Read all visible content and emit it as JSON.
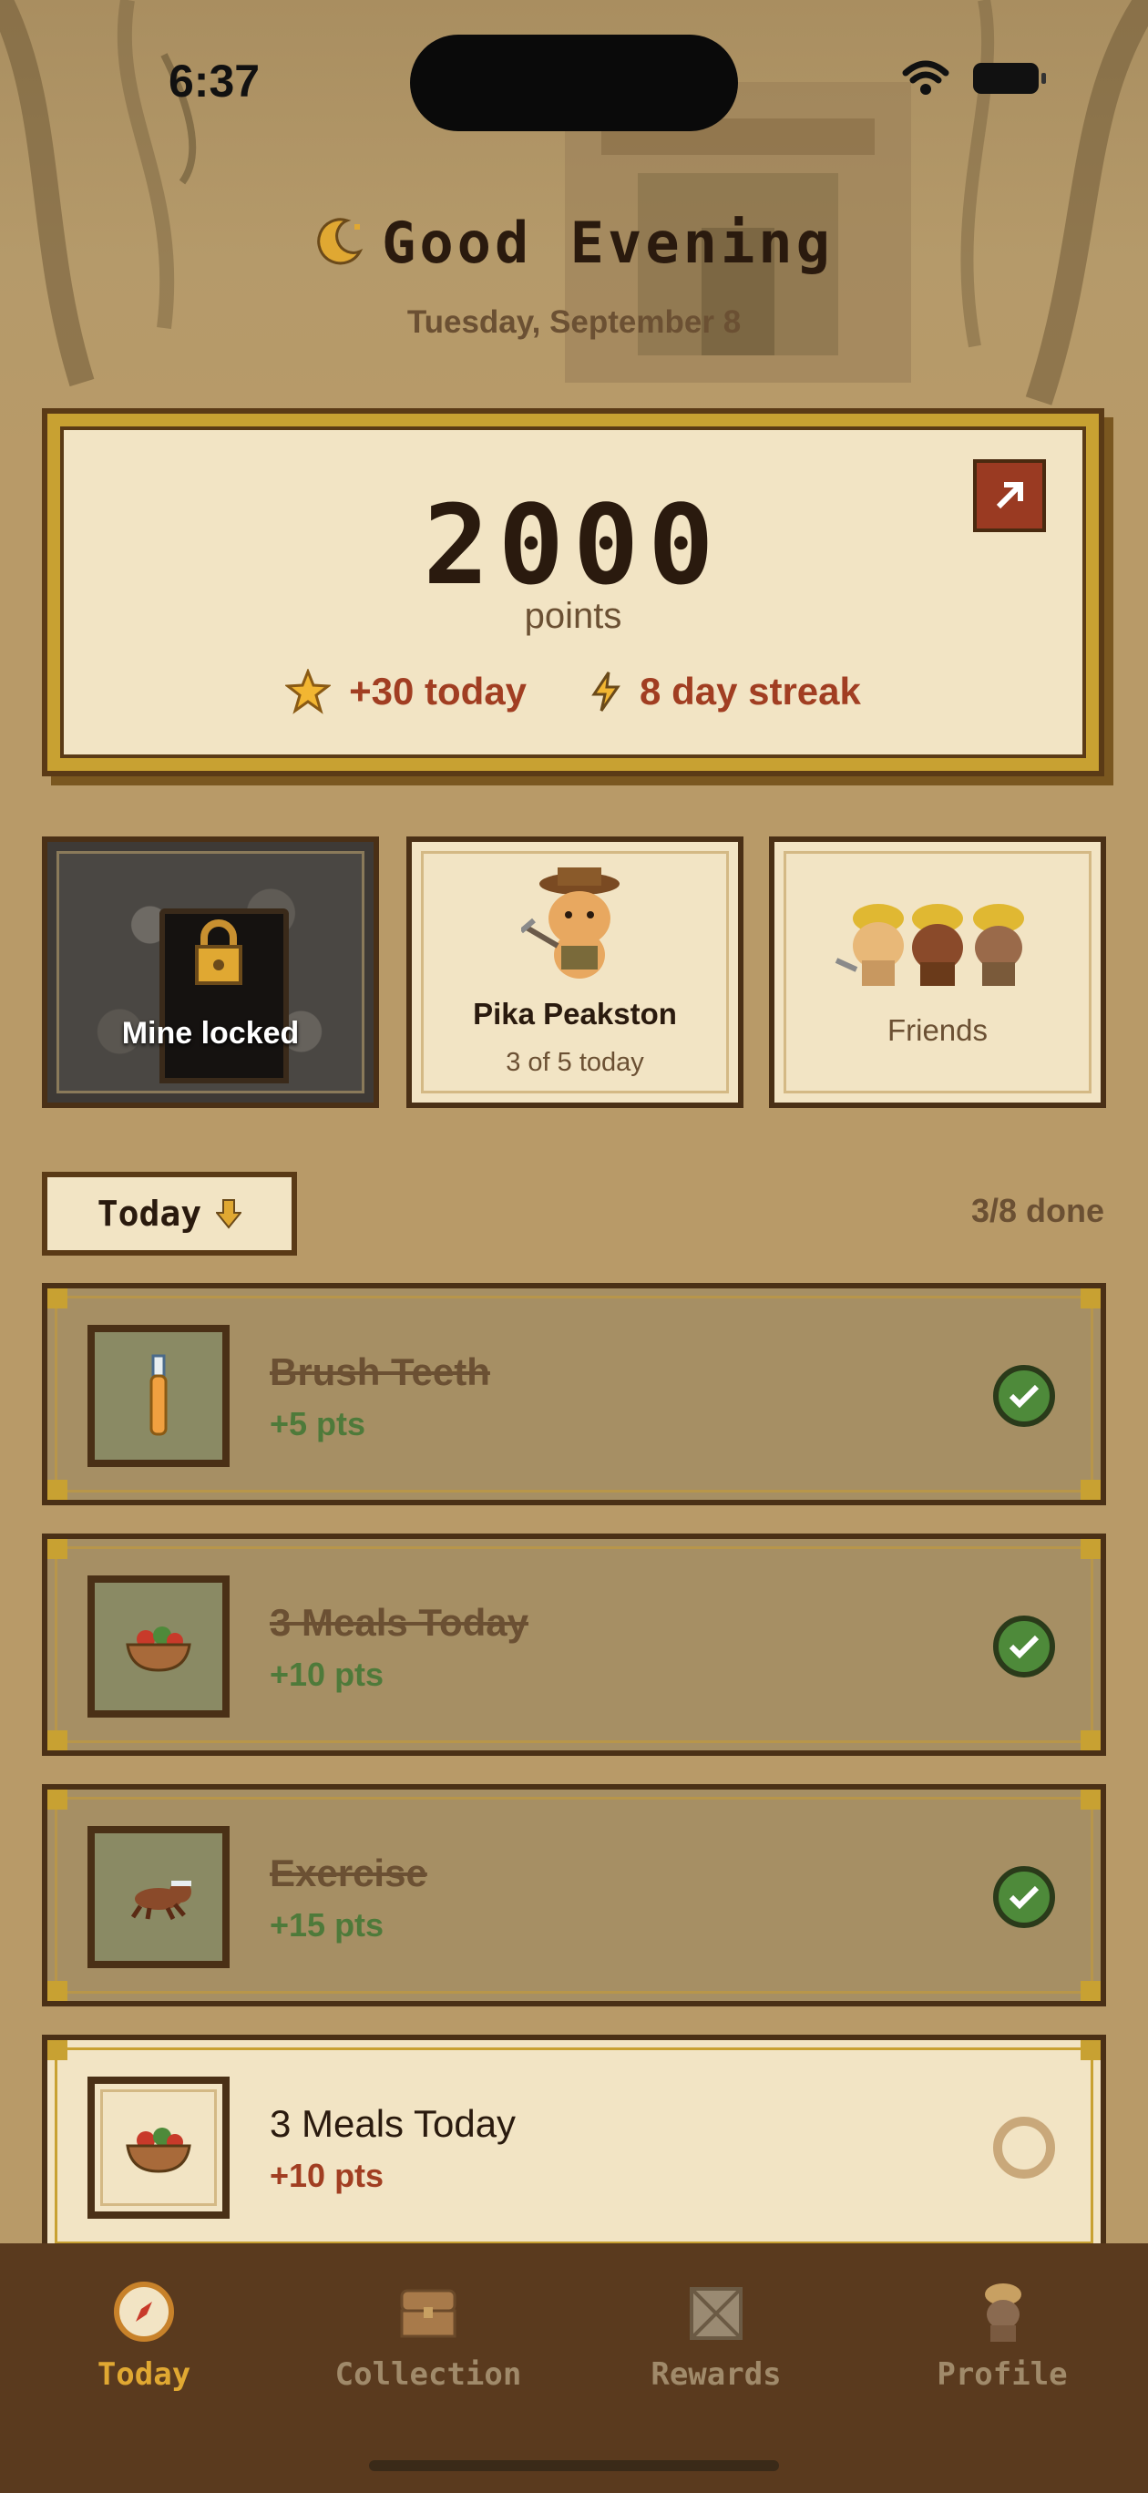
{
  "status": {
    "time": "6:37"
  },
  "header": {
    "greeting": "Good Evening",
    "date": "Tuesday, September 8"
  },
  "points": {
    "value": "2000",
    "label": "points",
    "today": "+30 today",
    "streak": "8 day streak"
  },
  "tiles": {
    "mine_label": "Mine locked",
    "pet_name": "Pika Peakston",
    "pet_sub": "3 of 5 today",
    "friends_label": "Friends"
  },
  "filter": {
    "label": "Today",
    "done": "3/8 done"
  },
  "tasks": [
    {
      "title": "Brush Teeth",
      "pts": "+5 pts",
      "done": true,
      "icon": "toothbrush-icon"
    },
    {
      "title": "3 Meals Today",
      "pts": "+10 pts",
      "done": true,
      "icon": "salad-bowl-icon"
    },
    {
      "title": "Exercise",
      "pts": "+15 pts",
      "done": true,
      "icon": "running-dog-icon"
    },
    {
      "title": "3 Meals Today",
      "pts": "+10 pts",
      "done": false,
      "icon": "salad-bowl-icon"
    }
  ],
  "tabs": [
    {
      "label": "Today",
      "icon": "compass-icon",
      "active": true
    },
    {
      "label": "Collection",
      "icon": "chest-icon",
      "active": false
    },
    {
      "label": "Rewards",
      "icon": "crate-icon",
      "active": false
    },
    {
      "label": "Profile",
      "icon": "miner-icon",
      "active": false
    }
  ],
  "colors": {
    "accent": "#a13e22",
    "done_green": "#4e7a3a",
    "tab_active": "#e0a832"
  }
}
